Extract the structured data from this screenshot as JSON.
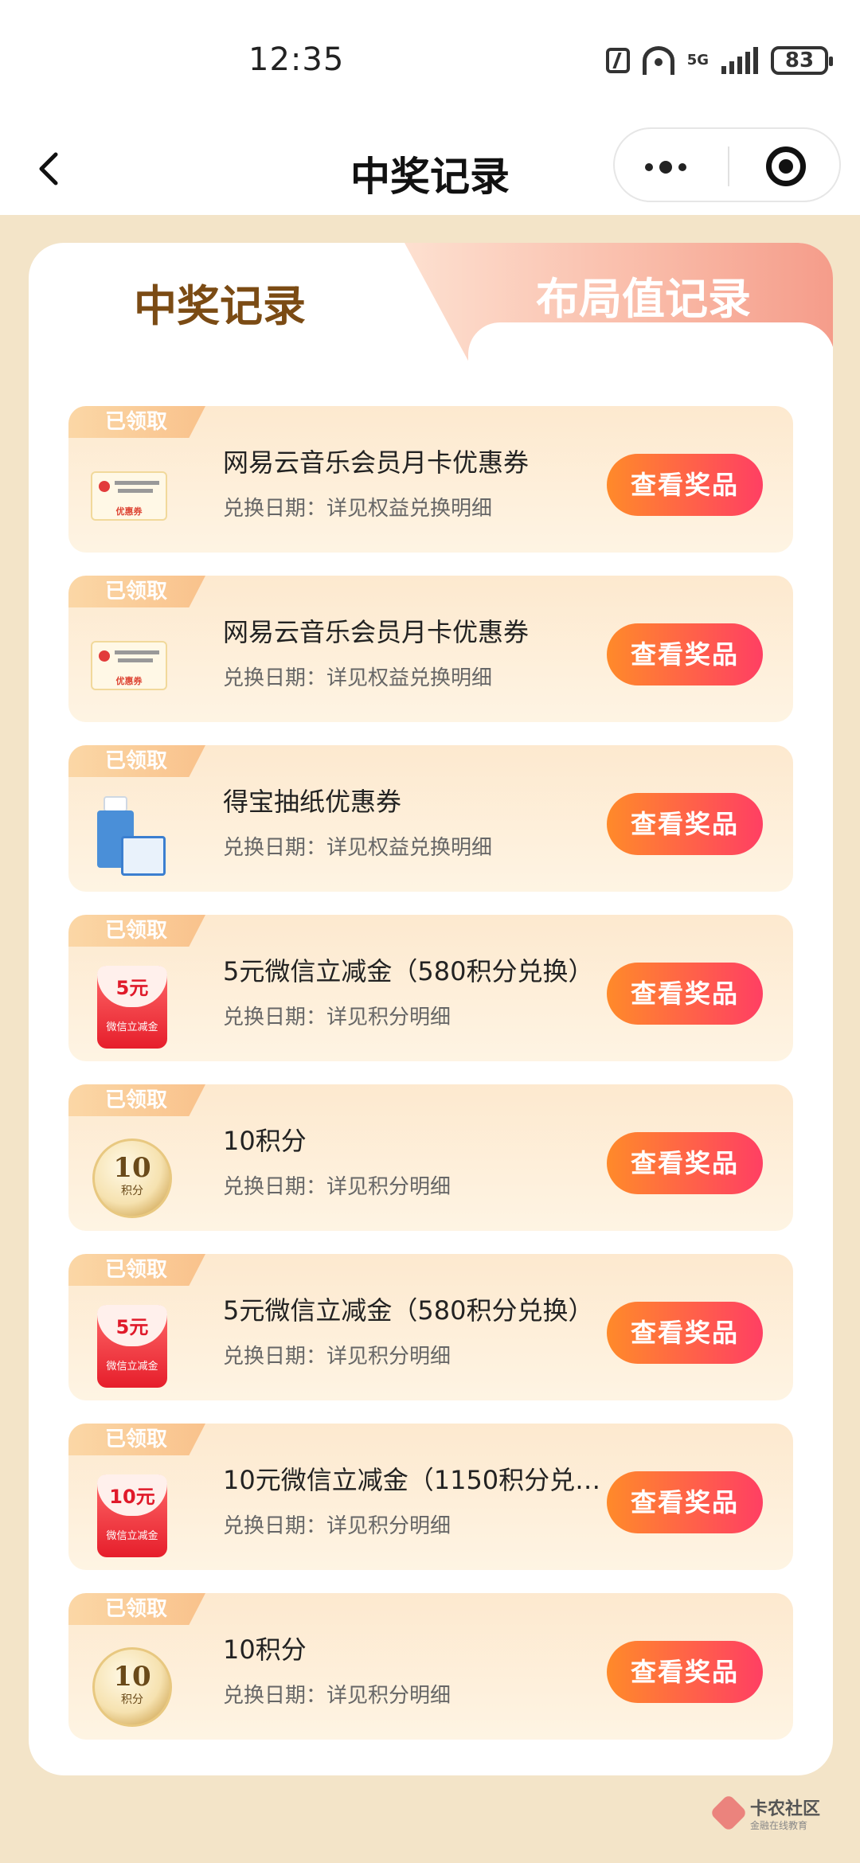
{
  "status_bar": {
    "time": "12:35",
    "network": "5G",
    "battery": "83"
  },
  "nav": {
    "title": "中奖记录"
  },
  "tabs": {
    "active": "中奖记录",
    "inactive": "布局值记录"
  },
  "items": [
    {
      "badge": "已领取",
      "title": "网易云音乐会员月卡优惠券",
      "sub": "兑换日期：详见权益兑换明细",
      "button": "查看奖品",
      "thumb": "coupon"
    },
    {
      "badge": "已领取",
      "title": "网易云音乐会员月卡优惠券",
      "sub": "兑换日期：详见权益兑换明细",
      "button": "查看奖品",
      "thumb": "coupon"
    },
    {
      "badge": "已领取",
      "title": "得宝抽纸优惠券",
      "sub": "兑换日期：详见权益兑换明细",
      "button": "查看奖品",
      "thumb": "tissue"
    },
    {
      "badge": "已领取",
      "title": "5元微信立减金（580积分兑换）",
      "sub": "兑换日期：详见积分明细",
      "button": "查看奖品",
      "thumb": "redpack",
      "amount": "5元",
      "thumb_caption": "微信立减金"
    },
    {
      "badge": "已领取",
      "title": "10积分",
      "sub": "兑换日期：详见积分明细",
      "button": "查看奖品",
      "thumb": "coin",
      "coin_num": "10",
      "coin_label": "积分"
    },
    {
      "badge": "已领取",
      "title": "5元微信立减金（580积分兑换）",
      "sub": "兑换日期：详见积分明细",
      "button": "查看奖品",
      "thumb": "redpack",
      "amount": "5元",
      "thumb_caption": "微信立减金"
    },
    {
      "badge": "已领取",
      "title": "10元微信立减金（1150积分兑…",
      "sub": "兑换日期：详见积分明细",
      "button": "查看奖品",
      "thumb": "redpack",
      "amount": "10元",
      "thumb_caption": "微信立减金"
    },
    {
      "badge": "已领取",
      "title": "10积分",
      "sub": "兑换日期：详见积分明细",
      "button": "查看奖品",
      "thumb": "coin",
      "coin_num": "10",
      "coin_label": "积分"
    }
  ],
  "coupon_thumb": {
    "tag": "优惠券"
  },
  "watermark": {
    "title": "卡农社区",
    "sub": "金融在线教育"
  },
  "colors": {
    "accent_button_start": "#ff8a2a",
    "accent_button_end": "#ff3f63",
    "page_bg": "#f3e4c8",
    "active_tab_text": "#7b4b14"
  }
}
